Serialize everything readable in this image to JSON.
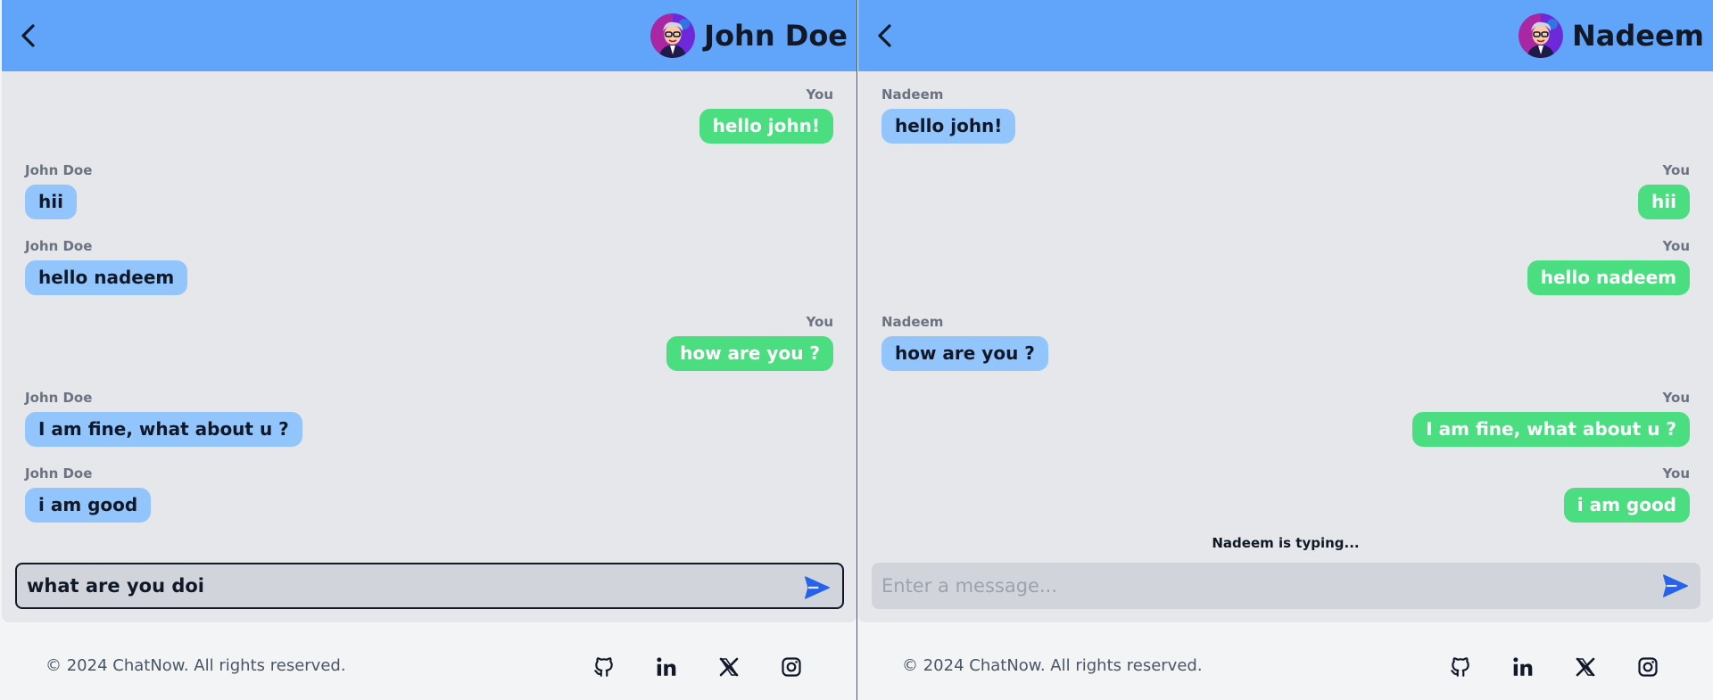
{
  "colors": {
    "header": "#60a5fa",
    "incoming_bubble": "#93c5fd",
    "outgoing_bubble": "#4ade80",
    "chat_background": "#e5e7eb",
    "input_background": "#d1d5db",
    "send_icon": "#2563eb"
  },
  "panes": [
    {
      "header": {
        "name": "John Doe",
        "avatar_icon": "cartoon-avatar-icon",
        "back_icon": "chevron-left-icon"
      },
      "messages": [
        {
          "sender": "You",
          "text": "hello john!",
          "direction": "out"
        },
        {
          "sender": "John Doe",
          "text": "hii",
          "direction": "in"
        },
        {
          "sender": "John Doe",
          "text": "hello nadeem",
          "direction": "in"
        },
        {
          "sender": "You",
          "text": "how are you ?",
          "direction": "out"
        },
        {
          "sender": "John Doe",
          "text": "I am fine, what about u ?",
          "direction": "in"
        },
        {
          "sender": "John Doe",
          "text": "i am good",
          "direction": "in"
        }
      ],
      "typing": "",
      "input": {
        "value": "what are you doi",
        "placeholder": "Enter a message...",
        "focused": true
      }
    },
    {
      "header": {
        "name": "Nadeem",
        "avatar_icon": "cartoon-avatar-icon",
        "back_icon": "chevron-left-icon"
      },
      "messages": [
        {
          "sender": "Nadeem",
          "text": "hello john!",
          "direction": "in"
        },
        {
          "sender": "You",
          "text": "hii",
          "direction": "out"
        },
        {
          "sender": "You",
          "text": "hello nadeem",
          "direction": "out"
        },
        {
          "sender": "Nadeem",
          "text": "how are you ?",
          "direction": "in"
        },
        {
          "sender": "You",
          "text": "I am fine, what about u ?",
          "direction": "out"
        },
        {
          "sender": "You",
          "text": "i am good",
          "direction": "out"
        }
      ],
      "typing": "Nadeem is typing...",
      "input": {
        "value": "",
        "placeholder": "Enter a message...",
        "focused": false
      }
    }
  ],
  "footer": {
    "copyright": "© 2024 ChatNow. All rights reserved.",
    "social_icons": [
      "github-icon",
      "linkedin-icon",
      "x-icon",
      "instagram-icon"
    ]
  }
}
